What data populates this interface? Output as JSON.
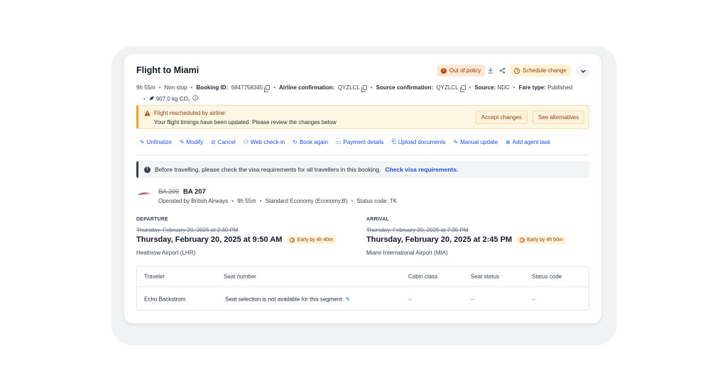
{
  "header": {
    "title": "Flight to Miami",
    "out_of_policy": "Out of policy",
    "schedule_change": "Schedule change"
  },
  "meta": {
    "duration": "9h 55m",
    "stops": "Non stop",
    "booking_id_label": "Booking ID:",
    "booking_id": "6847758345",
    "airline_conf_label": "Airline confirmation:",
    "airline_conf": "QYZLCL",
    "source_conf_label": "Source confirmation:",
    "source_conf": "QYZLCL",
    "source_label": "Source:",
    "source": "NDC",
    "fare_type_label": "Fare type:",
    "fare_type": "Published",
    "co2": "907.0 kg CO₂"
  },
  "alert": {
    "title": "Flight rescheduled by airline:",
    "body": "Your flight timings have been updated. Please review the changes below",
    "accept": "Accept changes",
    "alternatives": "See alternatives"
  },
  "actions": [
    {
      "icon": "pencil-icon",
      "glyph": "✎",
      "label": "Unfinalize"
    },
    {
      "icon": "edit-icon",
      "glyph": "✎",
      "label": "Modify"
    },
    {
      "icon": "cancel-icon",
      "glyph": "⊘",
      "label": "Cancel"
    },
    {
      "icon": "people-icon",
      "glyph": "⚇",
      "label": "Web check-in"
    },
    {
      "icon": "refresh-icon",
      "glyph": "↻",
      "label": "Book again"
    },
    {
      "icon": "card-icon",
      "glyph": "▭",
      "label": "Payment details"
    },
    {
      "icon": "document-icon",
      "glyph": "⎗",
      "label": "Upload documents"
    },
    {
      "icon": "edit-square-icon",
      "glyph": "✎",
      "label": "Manual update"
    },
    {
      "icon": "plus-circle-icon",
      "glyph": "⊕",
      "label": "Add agent task"
    }
  ],
  "visa": {
    "text": "Before travelling, please check the visa requirements for all travellers in this booking.",
    "link": "Check visa requirements."
  },
  "flight": {
    "old_number": "BA 209",
    "new_number": "BA 207",
    "operated_by": "Operated by British Airways",
    "duration": "9h 55m",
    "cabin": "Standard Economy (Economy,B)",
    "status": "Status code: TK"
  },
  "departure": {
    "label": "DEPARTURE",
    "old_time": "Thursday, February 20, 2025 at 2:30 PM",
    "new_time": "Thursday, February 20, 2025 at 9:50 AM",
    "early": "Early by 4h 40m",
    "airport": "Heathrow Airport (LHR)"
  },
  "arrival": {
    "label": "ARRIVAL",
    "old_time": "Thursday, February 20, 2025 at 7:35 PM",
    "new_time": "Thursday, February 20, 2025 at 2:45 PM",
    "early": "Early by 4h 50m",
    "airport": "Miami International Airport (MIA)"
  },
  "table": {
    "headers": [
      "Traveler",
      "Seat number",
      "Cabin class",
      "Seat status",
      "Status code"
    ],
    "rows": [
      {
        "traveler": "Echo Backstrom",
        "seat": "Seat selection is not available for this segment.",
        "cabin": "--",
        "seat_status": "--",
        "status_code": "--"
      }
    ]
  },
  "colors": {
    "link": "#1d4ed8",
    "warning_bg": "#fdf6e3",
    "warning_accent": "#f59e0b",
    "out_of_policy_bg": "#fde8d4"
  }
}
